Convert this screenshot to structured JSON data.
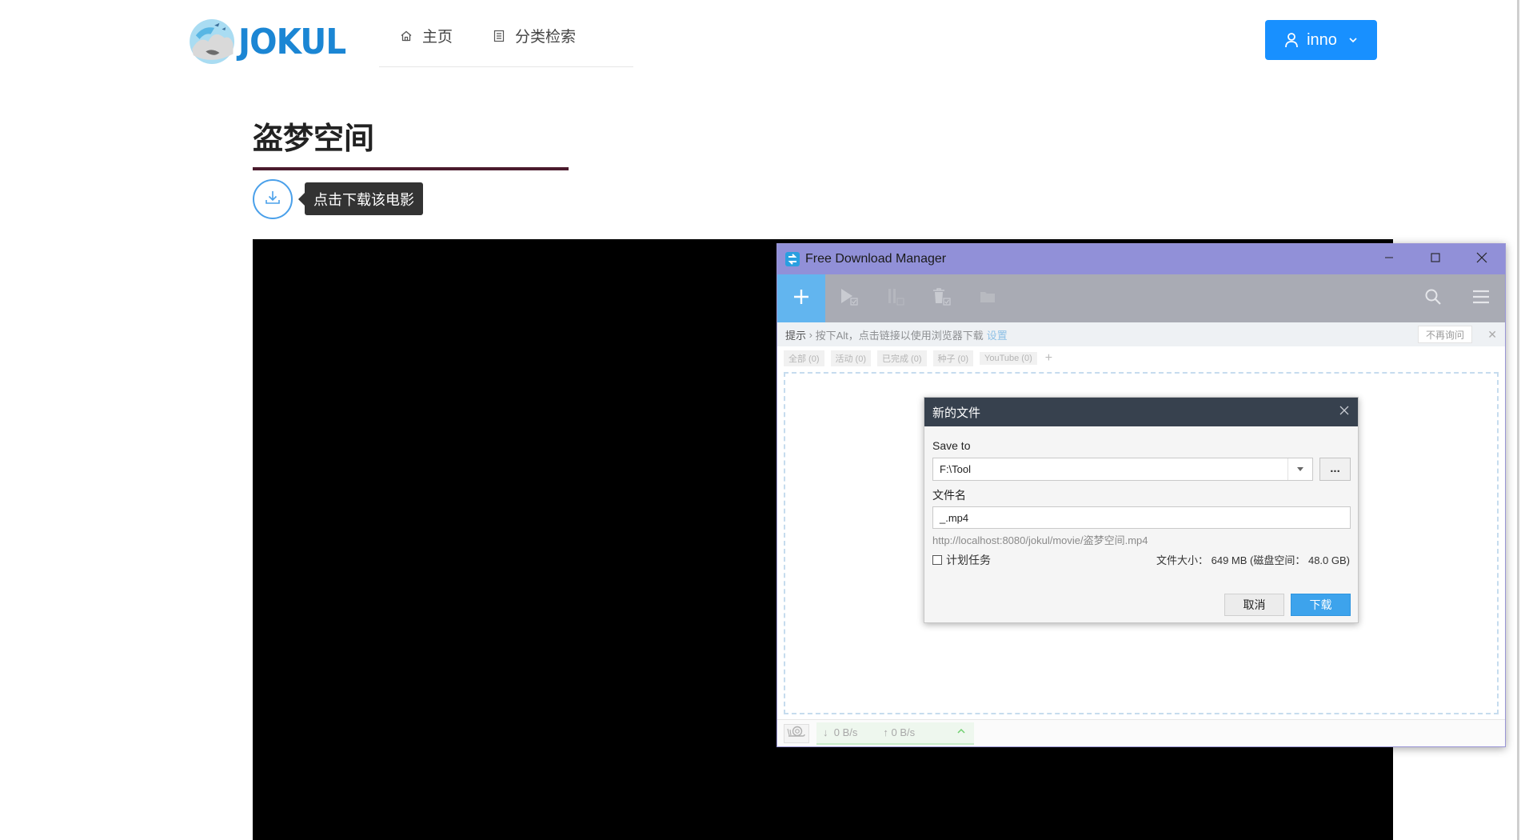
{
  "site": {
    "logo_text": "JOKUL",
    "nav": [
      {
        "label": "主页",
        "icon": "home-icon"
      },
      {
        "label": "分类检索",
        "icon": "list-icon"
      }
    ],
    "user": {
      "name": "inno",
      "icon": "user-icon"
    }
  },
  "movie": {
    "title": "盗梦空间",
    "download_tooltip": "点击下载该电影"
  },
  "fdm": {
    "window_title": "Free Download Manager",
    "toolbar": [
      "add-icon",
      "resume-icon",
      "pause-icon",
      "delete-icon",
      "folder-icon",
      "search-icon",
      "menu-icon"
    ],
    "hint": {
      "label": "提示",
      "text": "按下Alt，点击链接以使用浏览器下载",
      "link": "设置",
      "no_more": "不再询问"
    },
    "filters": [
      "全部 (0)",
      "活动 (0)",
      "已完成 (0)",
      "种子 (0)",
      "YouTube (0)"
    ],
    "status": {
      "down": "0 B/s",
      "up": "0 B/s"
    }
  },
  "dialog": {
    "title": "新的文件",
    "save_to_label": "Save to",
    "save_to_value": "F:\\Tool",
    "browse_label": "...",
    "filename_label": "文件名",
    "filename_value": "_.mp4",
    "url": "http://localhost:8080/jokul/movie/盗梦空间.mp4",
    "schedule_label": "计划任务",
    "size_text": "文件大小： 649 MB (磁盘空间： 48.0 GB)",
    "cancel_label": "取消",
    "download_label": "下载"
  },
  "colors": {
    "brand": "#1b86d4",
    "primary_button": "#1890ff",
    "fdm_titlebar": "#9190d8",
    "fdm_toolbar": "#a9abb4",
    "fdm_add": "#62b5ef",
    "dialog_header": "#37414e",
    "dialog_primary": "#3da3ec"
  }
}
